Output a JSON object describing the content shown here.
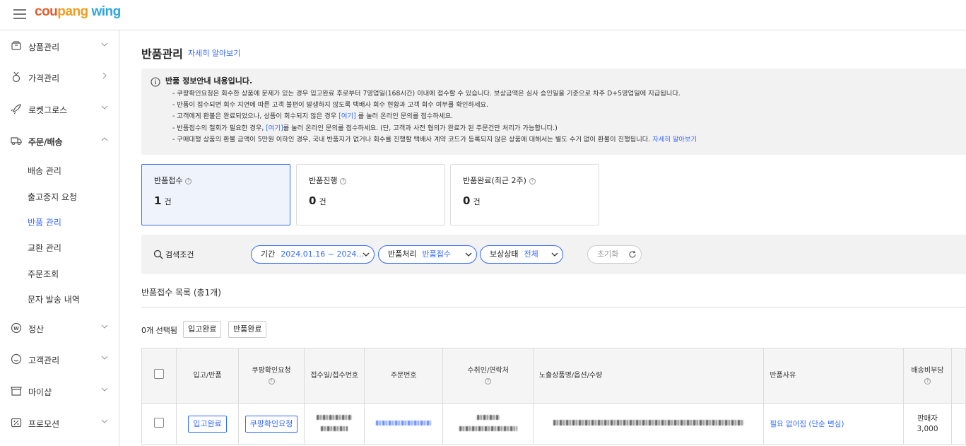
{
  "header": {
    "logo_parts": [
      "cou",
      "pang",
      " wing"
    ],
    "colors": {
      "accent": "#346aff",
      "logo_red": "#e35b2c",
      "logo_orange": "#f29c1d",
      "logo_blue": "#2ca6dc"
    }
  },
  "sidebar": {
    "items": [
      {
        "label": "상품관리",
        "icon": "box-icon",
        "state": "collapsed"
      },
      {
        "label": "가격관리",
        "icon": "price-medal-icon",
        "state": "link"
      },
      {
        "label": "로켓그로스",
        "icon": "rocket-icon",
        "state": "collapsed"
      },
      {
        "label": "주문/배송",
        "icon": "truck-icon",
        "state": "expanded"
      },
      {
        "label": "정산",
        "icon": "won-coin-icon",
        "state": "collapsed"
      },
      {
        "label": "고객관리",
        "icon": "smile-icon",
        "state": "collapsed"
      },
      {
        "label": "마이샵",
        "icon": "shop-icon",
        "state": "collapsed"
      },
      {
        "label": "프로모션",
        "icon": "percent-icon",
        "state": "collapsed"
      }
    ],
    "subitems": [
      "배송 관리",
      "출고중지 요청",
      "반품 관리",
      "교환 관리",
      "주문조회",
      "문자 발송 내역"
    ],
    "active_subitem": "반품 관리"
  },
  "page": {
    "title": "반품관리",
    "help_link": "자세히 알아보기"
  },
  "notice": {
    "heading": "반품 정보안내 내용입니다.",
    "lines": [
      {
        "pre": "- 쿠팡확인요청은 회수한 상품에 문제가 있는 경우 입고완료 후로부터 7영업일(168시간) 이내에 접수할 수 있습니다. 보상금액은 심사 승인일을 기준으로 차주 D+5영업일에 지급됩니다.",
        "link": "",
        "post": ""
      },
      {
        "pre": "- 반품이 접수되면 회수 지연에 따른 고객 불편이 발생하지 않도록 택배사 회수 현황과 고객 회수 여부를 확인하세요.",
        "link": "",
        "post": ""
      },
      {
        "pre": "- 고객에게 환불은 완료되었으나, 상품이 회수되지 않은 경우 ",
        "link": "[여기]",
        "post": " 를 눌러 온라인 문의를 접수하세요."
      },
      {
        "pre": "- 반품접수의 철회가 필요한 경우, ",
        "link": "[여기]",
        "post": "를 눌러 온라인 문의를 접수하세요. (단, 고객과 사전 협의가 완료가 된 주문건만 처리가 가능합니다.)"
      },
      {
        "pre": "- 구매대행 상품의 환불 금액이 5만원 이하인 경우, 국내 반품지가 없거나 회수를 진행할 택배사 계약 코드가 등록되지 않은 상품에 대해서는 별도 수거 없이 환불이 진행됩니다. ",
        "link": "자세히 알아보기",
        "post": ""
      }
    ]
  },
  "status_cards": [
    {
      "label": "반품접수",
      "count": "1",
      "unit": "건",
      "selected": true
    },
    {
      "label": "반품진행",
      "count": "0",
      "unit": "건",
      "selected": false
    },
    {
      "label": "반품완료(최근 2주)",
      "count": "0",
      "unit": "건",
      "selected": false
    }
  ],
  "filters": {
    "search_label": "검색조건",
    "chips": [
      {
        "name": "기간",
        "value": "2024.01.16 ~ 2024..."
      },
      {
        "name": "반품처리",
        "value": "반품접수"
      },
      {
        "name": "보상상태",
        "value": "전체"
      }
    ],
    "reset_label": "초기화"
  },
  "list": {
    "title": "반품접수 목록 (총1개)",
    "selected_count": "0개 선택됨",
    "bulk_buttons": [
      "입고완료",
      "반품완료"
    ],
    "columns": [
      "입고/반품",
      "쿠팡확인요청",
      "접수일/접수번호",
      "주문번호",
      "수취인/연락처",
      "노출상품명/옵션/수량",
      "반품사유",
      "배송비부담"
    ],
    "rows": [
      {
        "receive_button": "입고완료",
        "confirm_button": "쿠팡확인요청",
        "reason": "필요 없어짐 (단순 변심)",
        "shipping_payer": "판매자",
        "shipping_fee": "3,000"
      }
    ]
  }
}
